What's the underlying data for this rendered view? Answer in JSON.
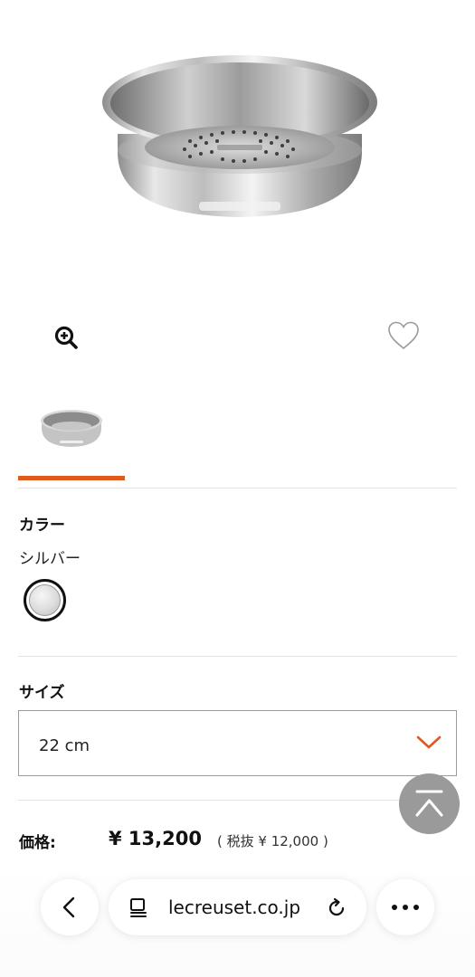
{
  "product": {
    "image_alt": "steamer-insert",
    "zoom_icon": "zoom-in-icon",
    "favorite_icon": "heart-icon"
  },
  "color": {
    "label": "カラー",
    "selected": "シルバー"
  },
  "size": {
    "label": "サイズ",
    "selected": "22 cm"
  },
  "price": {
    "label": "価格:",
    "value": "¥ 13,200",
    "tax_note": "( 税抜 ¥ 12,000 )"
  },
  "browser": {
    "url": "lecreuset.co.jp",
    "back_icon": "chevron-left-icon",
    "reader_icon": "reader-icon",
    "reload_icon": "reload-icon",
    "more_icon": "ellipsis-icon"
  },
  "colors": {
    "accent": "#e05a1b",
    "scroll_top_bg": "#9a9a9a"
  }
}
